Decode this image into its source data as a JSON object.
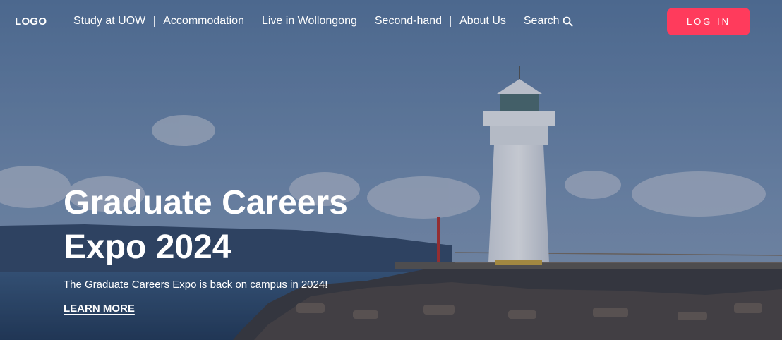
{
  "nav": {
    "logo": "LOGO",
    "items": [
      {
        "label": "Study at UOW"
      },
      {
        "label": "Accommodation"
      },
      {
        "label": "Live in Wollongong"
      },
      {
        "label": "Second-hand"
      },
      {
        "label": "About Us"
      },
      {
        "label": "Search"
      }
    ],
    "login_label": "LOG IN"
  },
  "hero": {
    "title": "Graduate Careers Expo 2024",
    "subtitle": "The Graduate Careers Expo is back on campus in 2024!",
    "cta": "LEARN MORE",
    "background": "lighthouse-on-breakwater-photo"
  },
  "colors": {
    "accent": "#ff3b5c",
    "sky": "#5d7ea6",
    "sea": "#2a4769",
    "text": "#ffffff"
  },
  "icons": {
    "search": "magnifier-icon"
  }
}
